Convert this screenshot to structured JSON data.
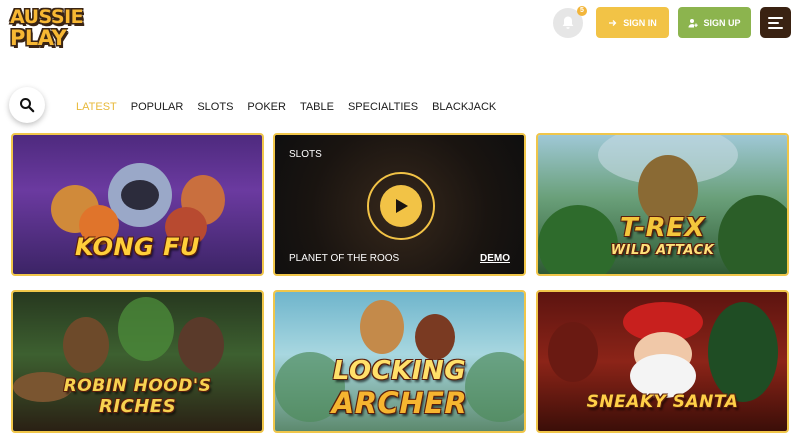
{
  "header": {
    "logo_line1": "AUSSIE",
    "logo_line2": "PLAY",
    "notification_count": "5",
    "sign_in_label": "SIGN IN",
    "sign_up_label": "SIGN UP",
    "icons": [
      "bell-icon",
      "sign-in-arrow-icon",
      "add-user-icon",
      "menu-icon"
    ]
  },
  "nav": {
    "search_icon": "search-icon",
    "tabs": [
      "LATEST",
      "POPULAR",
      "SLOTS",
      "POKER",
      "TABLE",
      "SPECIALTIES",
      "BLACKJACK"
    ],
    "active_tab": "LATEST"
  },
  "games": [
    {
      "title": "KONG FU"
    },
    {
      "category": "SLOTS",
      "name": "PLANET OF THE ROOS",
      "demo_label": "DEMO",
      "hovered": true
    },
    {
      "title_line1": "T-REX",
      "title_line2": "WILD ATTACK"
    },
    {
      "title_line1": "ROBIN HOOD'S",
      "title_line2": "RICHES"
    },
    {
      "title_line1": "LOCKING",
      "title_line2": "ARCHER"
    },
    {
      "title": "SNEAKY SANTA"
    }
  ],
  "colors": {
    "accent": "#f2c346",
    "signup": "#8cb44e",
    "menu": "#3a2212",
    "active_tab": "#e8b93a"
  }
}
